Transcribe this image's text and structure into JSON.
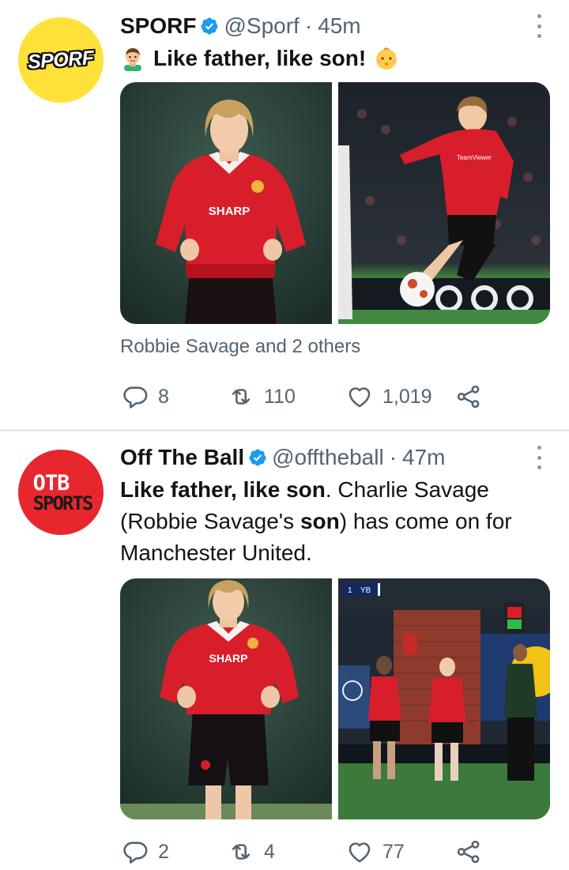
{
  "tweets": [
    {
      "author": {
        "name": "SPORF",
        "handle": "@Sporf",
        "time": "45m",
        "avatar_text": "SPORF",
        "verified": true
      },
      "text": {
        "lead_emoji": "man-emoji",
        "main": "Like father, like son!",
        "trail_emoji": "baby-emoji"
      },
      "media": [
        {
          "description": "Robbie Savage in red Manchester United SHARP shirt",
          "shirt_text": "SHARP"
        },
        {
          "description": "Charlie Savage dribbling the ball",
          "shirt_text": "TeamViewer"
        }
      ],
      "liked_by": "Robbie Savage and 2 others",
      "stats": {
        "replies": "8",
        "retweets": "110",
        "likes": "1,019"
      }
    },
    {
      "author": {
        "name": "Off The Ball",
        "handle": "@offtheball",
        "time": "47m",
        "avatar_text_1": "OTB",
        "avatar_text_2": "SPORTS",
        "verified": true
      },
      "text": {
        "p1": "Like father, like son",
        "p2": ". Charlie Savage (Robbie Savage's ",
        "p3": "son",
        "p4": ") has come on for Manchester United."
      },
      "media": [
        {
          "description": "Robbie Savage in red Manchester United SHARP shirt",
          "shirt_text": "SHARP"
        },
        {
          "description": "Substitution on the touchline",
          "score_team": "YB",
          "score_num": "1"
        }
      ],
      "stats": {
        "replies": "2",
        "retweets": "4",
        "likes": "77"
      }
    }
  ],
  "colors": {
    "verified": "#1d9bf0",
    "secondary_text": "#536471",
    "divider": "#e6ecf0",
    "sporf_yellow": "#ffe13a",
    "otb_red": "#e8262e",
    "united_red": "#d81e2a"
  }
}
